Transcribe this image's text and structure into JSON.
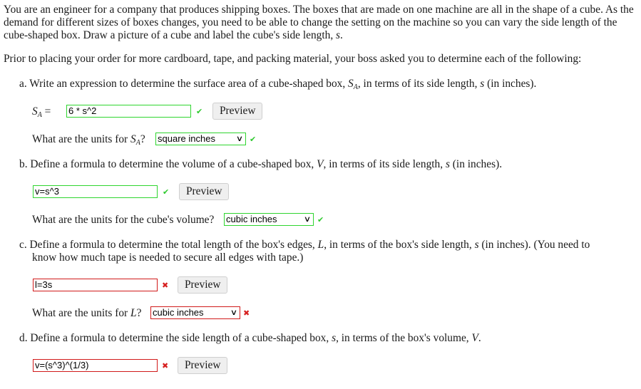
{
  "intro": {
    "text": "You are an engineer for a company that produces shipping boxes. The boxes that are made on one machine are all in the shape of a cube. As the demand for different sizes of boxes changes, you need to be able to change the setting on the machine so you can vary the side length of the cube-shaped box. Draw a picture of a cube and label the cube's side length, ",
    "var": "s",
    "end": "."
  },
  "prior": "Prior to placing your order for more cardboard, tape, and packing material, your boss asked you to determine each of the following:",
  "preview_label": "Preview",
  "parts": {
    "a": {
      "prompt_1": "a. Write an expression to determine the surface area of a cube-shaped box, ",
      "var_main": "S",
      "var_sub": "A",
      "prompt_2": ", in terms of its side length, ",
      "var_s": "s",
      "prompt_3": " (in inches).",
      "answer_label_var": "S",
      "answer_label_sub": "A",
      "answer_label_eq": " =",
      "answer_value": "6 * s^2",
      "answer_status": "correct",
      "units_q_1": "What are the units for ",
      "units_q_var": "S",
      "units_q_sub": "A",
      "units_q_2": "?",
      "units_value": "square inches",
      "units_status": "correct"
    },
    "b": {
      "prompt_1": "b. Define a formula to determine the volume of a cube-shaped box, ",
      "var_main": "V",
      "prompt_2": ", in terms of its side length, ",
      "var_s": "s",
      "prompt_3": " (in inches).",
      "answer_value": "v=s^3",
      "answer_status": "correct",
      "units_q": "What are the units for the cube's volume?",
      "units_value": "cubic inches",
      "units_status": "correct"
    },
    "c": {
      "prompt_1": "c. Define a formula to determine the total length of the box's edges, ",
      "var_main": "L",
      "prompt_2": ", in terms of the box's side length, ",
      "var_s": "s",
      "prompt_3": " (in inches). (You need to",
      "prompt_line2": "know how much tape is needed to secure all edges with tape.)",
      "answer_value": "l=3s",
      "answer_status": "incorrect",
      "units_q_1": "What are the units for ",
      "units_q_var": "L",
      "units_q_2": "?",
      "units_value": "cubic inches",
      "units_status": "incorrect"
    },
    "d": {
      "prompt_1": "d. Define a formula to determine the side length of a cube-shaped box, ",
      "var_s": "s",
      "prompt_2": ", in terms of the box's volume, ",
      "var_main": "V",
      "prompt_3": ".",
      "answer_value": "v=(s^3)^(1/3)",
      "answer_status": "incorrect"
    }
  },
  "icons": {
    "check": "✔",
    "cross": "✖",
    "chevron": "⌄"
  },
  "colors": {
    "correct": "#2fd52f",
    "incorrect": "#d11a1a"
  }
}
